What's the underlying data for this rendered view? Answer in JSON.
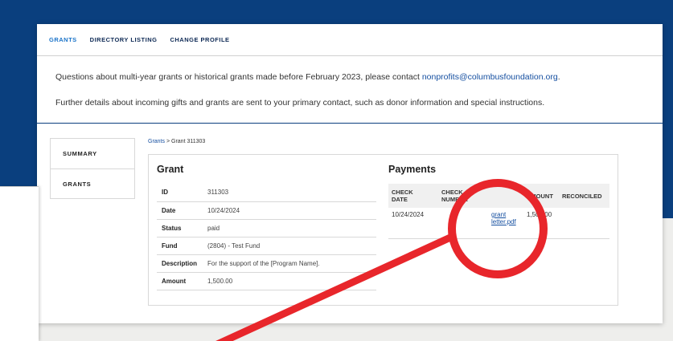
{
  "tabs": [
    {
      "label": "GRANTS",
      "active": true
    },
    {
      "label": "DIRECTORY LISTING",
      "active": false
    },
    {
      "label": "CHANGE PROFILE",
      "active": false
    }
  ],
  "notice": {
    "line1_text": "Questions about multi-year grants or historical grants made before February 2023, please contact ",
    "line1_email": "nonprofits@columbusfoundation.org",
    "line1_end": ".",
    "line2_text": "Further details about incoming gifts and grants are sent to your primary contact, such as donor information and special instructions."
  },
  "sidebar": {
    "items": [
      {
        "label": "SUMMARY"
      },
      {
        "label": "GRANTS"
      }
    ]
  },
  "breadcrumb": {
    "parent": "Grants",
    "separator": ">",
    "current": "Grant 311303"
  },
  "grant": {
    "title": "Grant",
    "rows": [
      {
        "key": "ID",
        "value": "311303"
      },
      {
        "key": "Date",
        "value": "10/24/2024"
      },
      {
        "key": "Status",
        "value": "paid"
      },
      {
        "key": "Fund",
        "value": "(2804) - Test Fund"
      },
      {
        "key": "Description",
        "value": "For the support of the [Program Name]."
      },
      {
        "key": "Amount",
        "value": "1,500.00"
      }
    ]
  },
  "payments": {
    "title": "Payments",
    "headers": {
      "check_date_1": "CHECK",
      "check_date_2": "DATE",
      "check_number_1": "CHECK",
      "check_number_2": "NUMBER",
      "document": "",
      "amount": "AMOUNT",
      "reconciled": "RECONCILED"
    },
    "rows": [
      {
        "check_date": "10/24/2024",
        "check_number": "",
        "doc_line1": "grant",
        "doc_line2": "letter.pdf",
        "amount": "1,500.00",
        "reconciled": ""
      }
    ]
  },
  "colors": {
    "brand_navy": "#0a3f7e",
    "link_blue": "#154fa0",
    "annotation_red": "#e8262b"
  },
  "annotation": "red circle and arrow highlighting the grant letter.pdf link"
}
